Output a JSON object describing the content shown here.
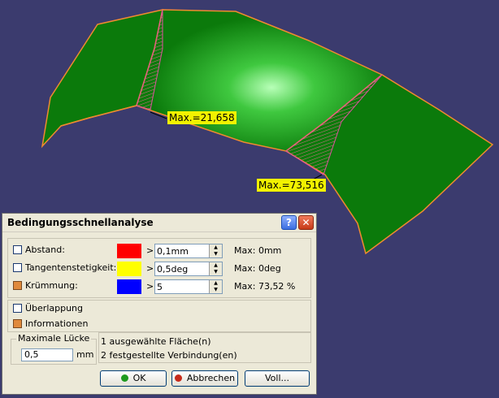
{
  "viewport": {
    "max_labels": [
      "Max.=21,658",
      "Max.=73,516"
    ]
  },
  "dialog": {
    "title": "Bedingungsschnellanalyse",
    "help_button": "?",
    "close_button": "✕",
    "rows": [
      {
        "label": "Abstand:",
        "checked": false,
        "color": "#ff0000",
        "op": ">",
        "value": "0,1mm",
        "max": "Max: 0mm"
      },
      {
        "label": "Tangentenstetigkeit:",
        "checked": false,
        "color": "#ffff00",
        "op": ">",
        "value": "0,5deg",
        "max": "Max: 0deg"
      },
      {
        "label": "Krümmung:",
        "checked": true,
        "color": "#0000ff",
        "op": ">",
        "value": "5",
        "max": "Max: 73,52 %"
      }
    ],
    "overlap_label": "Überlappung",
    "overlap_checked": false,
    "info_label": "Informationen",
    "info_checked": true,
    "max_gap": {
      "legend": "Maximale Lücke",
      "value": "0,5",
      "unit": "mm"
    },
    "info_lines": [
      "1 ausgewählte Fläche(n)",
      "2 festgestellte Verbindung(en)"
    ],
    "buttons": {
      "ok": "OK",
      "cancel": "Abbrechen",
      "full": "Voll..."
    }
  }
}
